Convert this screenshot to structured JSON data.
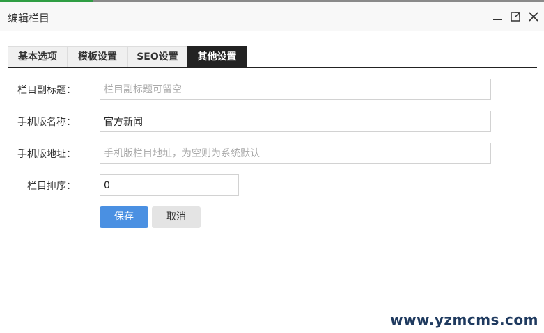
{
  "window": {
    "title": "编辑栏目"
  },
  "tabs": [
    {
      "label": "基本选项"
    },
    {
      "label": "模板设置"
    },
    {
      "label": "SEO设置"
    },
    {
      "label": "其他设置"
    }
  ],
  "form": {
    "subtitle": {
      "label": "栏目副标题：",
      "value": "",
      "placeholder": "栏目副标题可留空"
    },
    "mobile_name": {
      "label": "手机版名称：",
      "value": "官方新闻",
      "placeholder": ""
    },
    "mobile_url": {
      "label": "手机版地址：",
      "value": "",
      "placeholder": "手机版栏目地址，为空则为系统默认"
    },
    "order": {
      "label": "栏目排序：",
      "value": "0",
      "placeholder": ""
    }
  },
  "buttons": {
    "save": "保存",
    "cancel": "取消"
  },
  "watermark": "www.yzmcms.com",
  "icons": {
    "minimize": "minimize-icon",
    "maximize": "maximize-icon",
    "close": "close-icon"
  },
  "colors": {
    "active_tab": "#222222",
    "save_button": "#4a90e2",
    "cancel_button": "#e4e4e4"
  }
}
